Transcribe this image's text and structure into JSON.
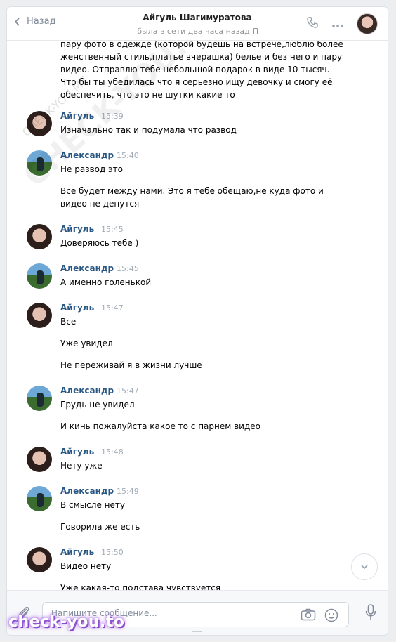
{
  "header": {
    "back_label": "Назад",
    "title": "Айгуль Шагимуратова",
    "status": "была в сети два часа назад"
  },
  "top_message": {
    "lines": [
      "пару фото в одежде (которой будешь на встрече,люблю более",
      "женственный стиль,платье вчерашка) белье и без него и пару",
      "видео. Отправлю тебе небольшой подарок в виде 10 тысяч.",
      "Что бы ты убедилась что я серьезно ищу девочку и смогу её",
      "обеспечить, что это не шутки какие то"
    ]
  },
  "messages": [
    {
      "author": "Айгуль",
      "time": "15:39",
      "lines": [
        "Изначально так и подумала что развод"
      ]
    },
    {
      "author": "Александр",
      "time": "15:40",
      "lines": [
        "Не развод это",
        "",
        "Все будет между нами. Это я тебе обещаю,не куда фото и",
        "видео не денутся"
      ]
    },
    {
      "author": "Айгуль",
      "time": "15:45",
      "lines": [
        "Доверяюсь тебе )"
      ]
    },
    {
      "author": "Александр",
      "time": "15:45",
      "lines": [
        "А именно голенькой"
      ]
    },
    {
      "author": "Айгуль",
      "time": "15:47",
      "lines": [
        "Все",
        "",
        "Уже увидел",
        "",
        "Не переживай я в жизни лучше"
      ]
    },
    {
      "author": "Александр",
      "time": "15:47",
      "lines": [
        "Грудь не увидел",
        "",
        "И кинь пожалуйста какое то с парнем видео"
      ]
    },
    {
      "author": "Айгуль",
      "time": "15:48",
      "lines": [
        "Нету уже"
      ]
    },
    {
      "author": "Александр",
      "time": "15:49",
      "lines": [
        "В смысле нету",
        "",
        "Говорила же есть"
      ]
    },
    {
      "author": "Айгуль",
      "time": "15:50",
      "lines": [
        "Видео нету",
        "",
        "Уже какая-то подстава чувствуется"
      ]
    }
  ],
  "composer": {
    "placeholder": "Напишите сообщение..."
  },
  "watermark": {
    "small": "CHECK-YOU.ME",
    "large": "CHECK-YOU.ME",
    "brand": "check-you.to"
  },
  "icons": [
    "chevron-left-icon",
    "phone-icon",
    "more-icon",
    "paperclip-icon",
    "camera-icon",
    "smile-icon",
    "microphone-icon",
    "chevron-down-icon"
  ],
  "colors": {
    "author_name": "#2a5885",
    "timestamp": "#a3adb8",
    "background": "#edeef0"
  }
}
